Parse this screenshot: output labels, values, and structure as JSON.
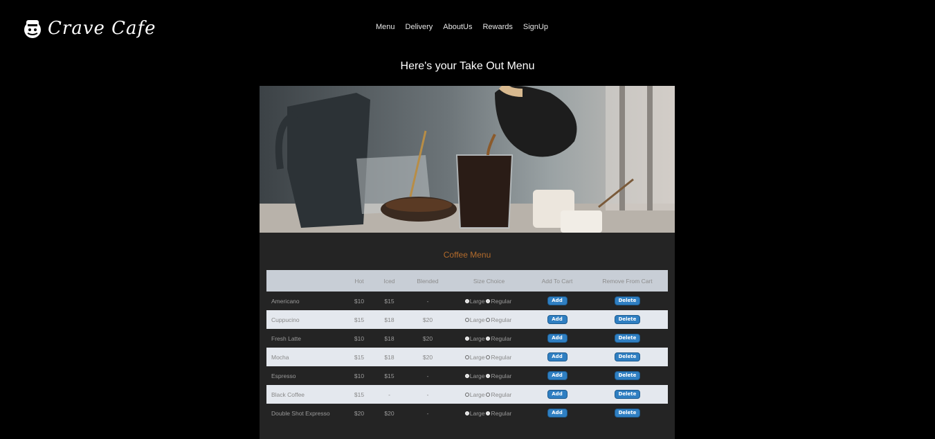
{
  "brand": {
    "name": "Crave Cafe",
    "icon": "chef-mascot-icon"
  },
  "nav": {
    "items": [
      "Menu",
      "Delivery",
      "AboutUs",
      "Rewards",
      "SignUp"
    ]
  },
  "page_title": "Here's your Take Out Menu",
  "hero": {
    "image": "coffee-pouring-photo"
  },
  "menu": {
    "title": "Coffee Menu",
    "headers": [
      "",
      "Hot",
      "Iced",
      "Blended",
      "Size Choice",
      "Add To Cart",
      "Remove From Cart"
    ],
    "size_labels": {
      "large": "Large",
      "regular": "Regular"
    },
    "button_labels": {
      "add": "Add",
      "delete": "Delete"
    },
    "rows": [
      {
        "name": "Americano",
        "hot": "$10",
        "iced": "$15",
        "blended": "-"
      },
      {
        "name": "Cuppucino",
        "hot": "$15",
        "iced": "$18",
        "blended": "$20"
      },
      {
        "name": "Fresh Latte",
        "hot": "$10",
        "iced": "$18",
        "blended": "$20"
      },
      {
        "name": "Mocha",
        "hot": "$15",
        "iced": "$18",
        "blended": "$20"
      },
      {
        "name": "Espresso",
        "hot": "$10",
        "iced": "$15",
        "blended": "-"
      },
      {
        "name": "Black Coffee",
        "hot": "$15",
        "iced": "-",
        "blended": "-"
      },
      {
        "name": "Double Shot Expresso",
        "hot": "$20",
        "iced": "$20",
        "blended": "-"
      }
    ]
  },
  "colors": {
    "background": "#000000",
    "panel": "#242424",
    "menu_title": "#b36b2c",
    "button": "#2f7fc2",
    "header_row": "#c8ced6",
    "light_row": "#e4e8ee"
  }
}
